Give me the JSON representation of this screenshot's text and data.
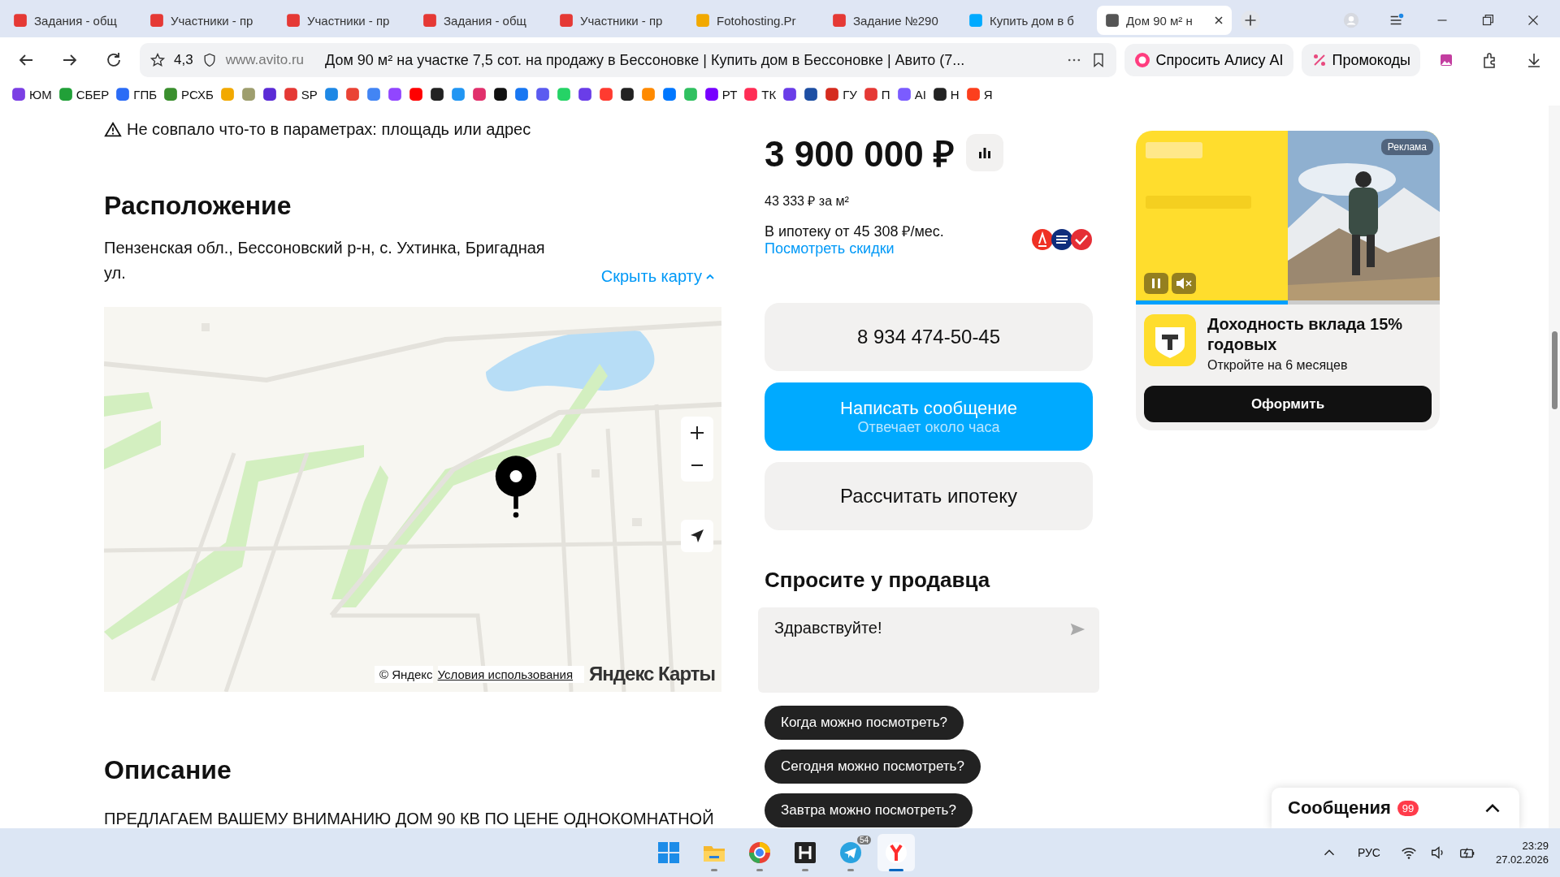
{
  "tabs": [
    {
      "title": "Задания - общ",
      "color": "#e53935",
      "selected": false
    },
    {
      "title": "Участники - пр",
      "color": "#e53935",
      "selected": false
    },
    {
      "title": "Участники - пр",
      "color": "#e53935",
      "selected": false
    },
    {
      "title": "Задания - общ",
      "color": "#e53935",
      "selected": false
    },
    {
      "title": "Участники - пр",
      "color": "#e53935",
      "selected": false
    },
    {
      "title": "Fotohosting.Pr",
      "color": "#f2a900",
      "selected": false
    },
    {
      "title": "Задание №290",
      "color": "#e53935",
      "selected": false
    },
    {
      "title": "Купить дом в б",
      "color": "#00aaff",
      "selected": false
    },
    {
      "title": "Дом 90 м² н",
      "color": "#555555",
      "selected": true
    }
  ],
  "address_bar": {
    "rating": "4,3",
    "domain": "www.avito.ru",
    "page_title": "Дом 90 м² на участке 7,5 сот. на продажу в Бессоновке | Купить дом в Бессоновке | Авито (7...",
    "alice_button": "Спросить Алису AI",
    "promo_button": "Промокоды"
  },
  "bookmarks": [
    {
      "label": "ЮМ",
      "color": "#7b3fe4"
    },
    {
      "label": "СБЕР",
      "color": "#21a038"
    },
    {
      "label": "ГПБ",
      "color": "#2b6cf6"
    },
    {
      "label": "РСХБ",
      "color": "#3a8f2e"
    },
    {
      "color": "#f2a900"
    },
    {
      "color": "#9e9e6e"
    },
    {
      "color": "#5b2bd6"
    },
    {
      "label": "SP",
      "color": "#e53935"
    },
    {
      "color": "#1e88e5"
    },
    {
      "color": "#ea4335"
    },
    {
      "color": "#4285f4"
    },
    {
      "color": "#9146ff"
    },
    {
      "color": "#ff0000"
    },
    {
      "color": "#222222"
    },
    {
      "color": "#2196f3"
    },
    {
      "color": "#e1306c"
    },
    {
      "color": "#111111"
    },
    {
      "color": "#1877f2"
    },
    {
      "color": "#5b5bf0"
    },
    {
      "color": "#25d366"
    },
    {
      "color": "#6a3de8"
    },
    {
      "color": "#ff3b30"
    },
    {
      "color": "#222222"
    },
    {
      "color": "#ff8a00"
    },
    {
      "color": "#0077ff"
    },
    {
      "color": "#30c060"
    },
    {
      "label": "РТ",
      "color": "#7700ff"
    },
    {
      "label": "ТК",
      "color": "#ff2d55"
    },
    {
      "color": "#6a3de8"
    },
    {
      "color": "#1e4fa3"
    },
    {
      "label": "ГУ",
      "color": "#d52b1e"
    },
    {
      "label": "П",
      "color": "#e53935"
    },
    {
      "label": "AI",
      "color": "#7b5cff"
    },
    {
      "label": "Н",
      "color": "#222222"
    },
    {
      "label": "Я",
      "color": "#fc3f1d"
    }
  ],
  "page": {
    "notice": "Не совпало что-то в параметрах: площадь или адрес",
    "location": {
      "heading": "Расположение",
      "address": "Пензенская обл., Бессоновский р-н, с. Ухтинка, Бригадная ул.",
      "hide_map_link": "Скрыть карту"
    },
    "map": {
      "copyright": "© Яндекс",
      "terms_link": "Условия использования",
      "logo": "Яндекс Карты"
    },
    "description": {
      "heading": "Описание",
      "text": "ПРЕДЛАГАЕМ ВАШЕМУ ВНИМАНИЮ ДОМ 90 КВ ПО ЦЕНЕ ОДНОКОМНАТНОЙ"
    }
  },
  "offer": {
    "price": "3 900 000 ₽",
    "price_per_m2": "43 333 ₽ за м²",
    "mortgage": "В ипотеку от 45 308 ₽/мес.",
    "discounts_link": "Посмотреть скидки",
    "phone": "8 934 474-50-45",
    "message_button": {
      "label": "Написать сообщение",
      "sublabel": "Отвечает около часа"
    },
    "mortgage_button": "Рассчитать ипотеку",
    "ask_heading": "Спросите у продавца",
    "message_field": {
      "value": "Здравствуйте!"
    },
    "quick_questions": [
      "Когда можно посмотреть?",
      "Сегодня можно посмотреть?",
      "Завтра можно посмотреть?"
    ]
  },
  "ad": {
    "badge": "Реклама",
    "progress": {
      "level": 0.5
    },
    "title": "Доходность вклада 15% годовых",
    "subtitle": "Откройте на 6 месяцев",
    "button": "Оформить"
  },
  "messages_widget": {
    "title": "Сообщения",
    "badge": "99",
    "expanded": false
  },
  "taskbar": {
    "apps": [
      {
        "kind": "start",
        "running": false,
        "selected": false
      },
      {
        "kind": "folder",
        "running": true,
        "selected": false
      },
      {
        "kind": "browser",
        "running": true,
        "selected": false
      },
      {
        "kind": "letter-app",
        "running": true,
        "selected": false
      },
      {
        "kind": "telegram",
        "running": true,
        "selected": false,
        "badge": "54"
      },
      {
        "kind": "yandex",
        "running": true,
        "selected": true
      }
    ],
    "language": "РУС",
    "time": "23:29",
    "date": "27.02.2026"
  }
}
